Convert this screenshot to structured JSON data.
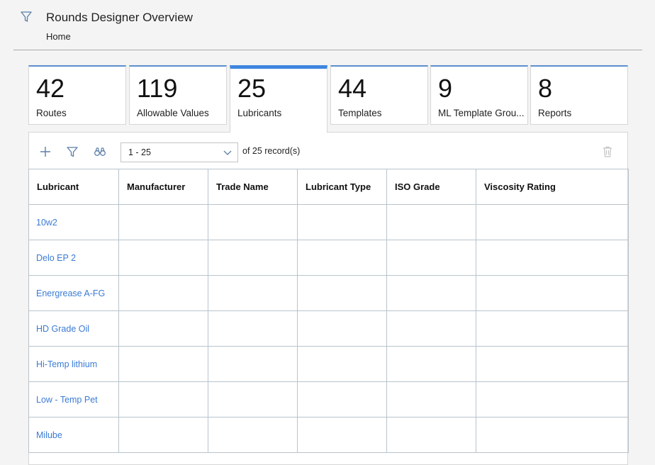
{
  "header": {
    "title": "Rounds Designer Overview",
    "breadcrumb": "Home"
  },
  "tiles": [
    {
      "count": "42",
      "label": "Routes"
    },
    {
      "count": "119",
      "label": "Allowable Values"
    },
    {
      "count": "25",
      "label": "Lubricants"
    },
    {
      "count": "44",
      "label": "Templates"
    },
    {
      "count": "9",
      "label": "ML Template Grou..."
    },
    {
      "count": "8",
      "label": "Reports"
    }
  ],
  "toolbar": {
    "pager_value": "1 - 25",
    "record_text": "of 25 record(s)"
  },
  "table": {
    "columns": [
      "Lubricant",
      "Manufacturer",
      "Trade Name",
      "Lubricant Type",
      "ISO Grade",
      "Viscosity Rating"
    ],
    "rows": [
      [
        "10w2",
        "",
        "",
        "",
        "",
        ""
      ],
      [
        "Delo EP 2",
        "",
        "",
        "",
        "",
        ""
      ],
      [
        "Energrease A-FG",
        "",
        "",
        "",
        "",
        ""
      ],
      [
        "HD Grade Oil",
        "",
        "",
        "",
        "",
        ""
      ],
      [
        "Hi-Temp lithium",
        "",
        "",
        "",
        "",
        ""
      ],
      [
        "Low - Temp Pet",
        "",
        "",
        "",
        "",
        ""
      ],
      [
        "Milube",
        "",
        "",
        "",
        "",
        ""
      ]
    ]
  },
  "colors": {
    "accent": "#3e86e0",
    "link": "#3a7bd5",
    "icon": "#5b7fa8"
  }
}
